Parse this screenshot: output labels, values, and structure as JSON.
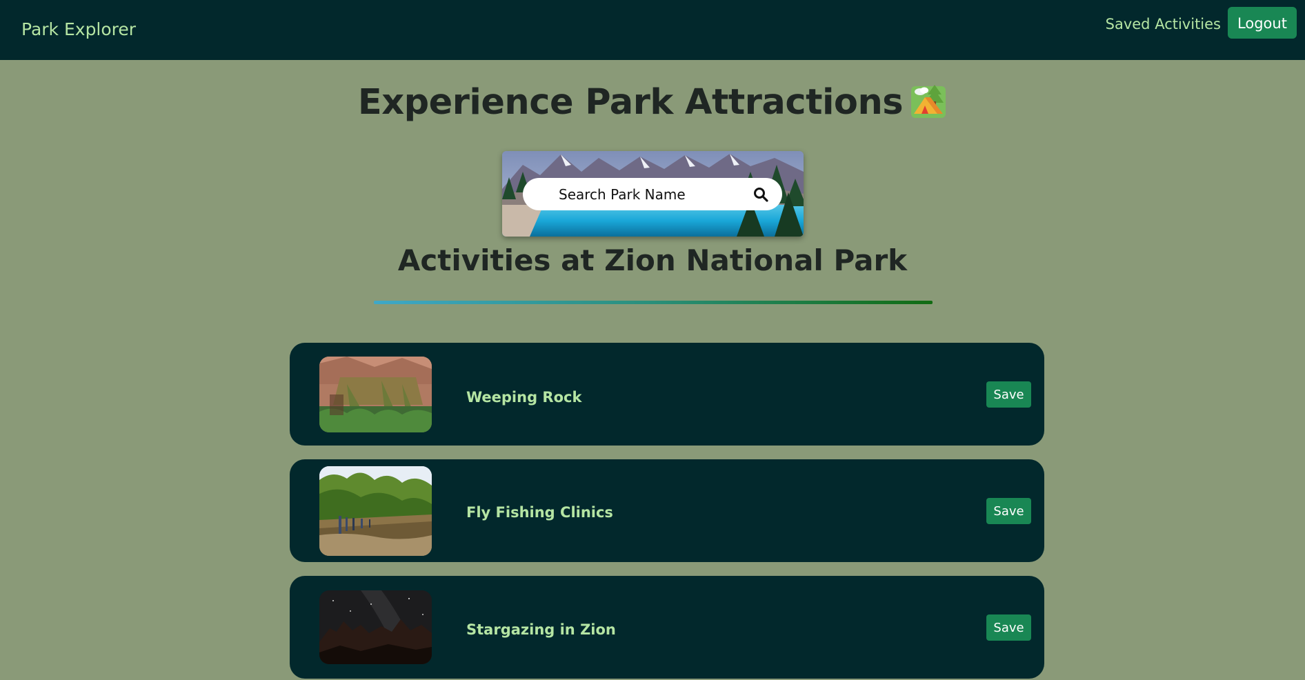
{
  "navbar": {
    "brand": "Park Explorer",
    "saved_link": "Saved Activities",
    "logout_label": "Logout"
  },
  "page": {
    "title": "Experience Park Attractions",
    "title_icon": "camping-tent-icon"
  },
  "search": {
    "placeholder": "Search Park Name",
    "value": "",
    "icon": "search-icon"
  },
  "section": {
    "heading": "Activities at Zion National Park"
  },
  "activities": [
    {
      "name": "Weeping Rock",
      "save_label": "Save",
      "thumbnail": "weeping-rock-photo"
    },
    {
      "name": "Fly Fishing Clinics",
      "save_label": "Save",
      "thumbnail": "fly-fishing-photo"
    },
    {
      "name": "Stargazing in Zion",
      "save_label": "Save",
      "thumbnail": "stargazing-photo"
    }
  ],
  "colors": {
    "navbar_bg": "#02282c",
    "page_bg": "#8a9a78",
    "accent_text": "#b5e5a3",
    "button_green": "#198754",
    "card_bg": "#02282c"
  }
}
